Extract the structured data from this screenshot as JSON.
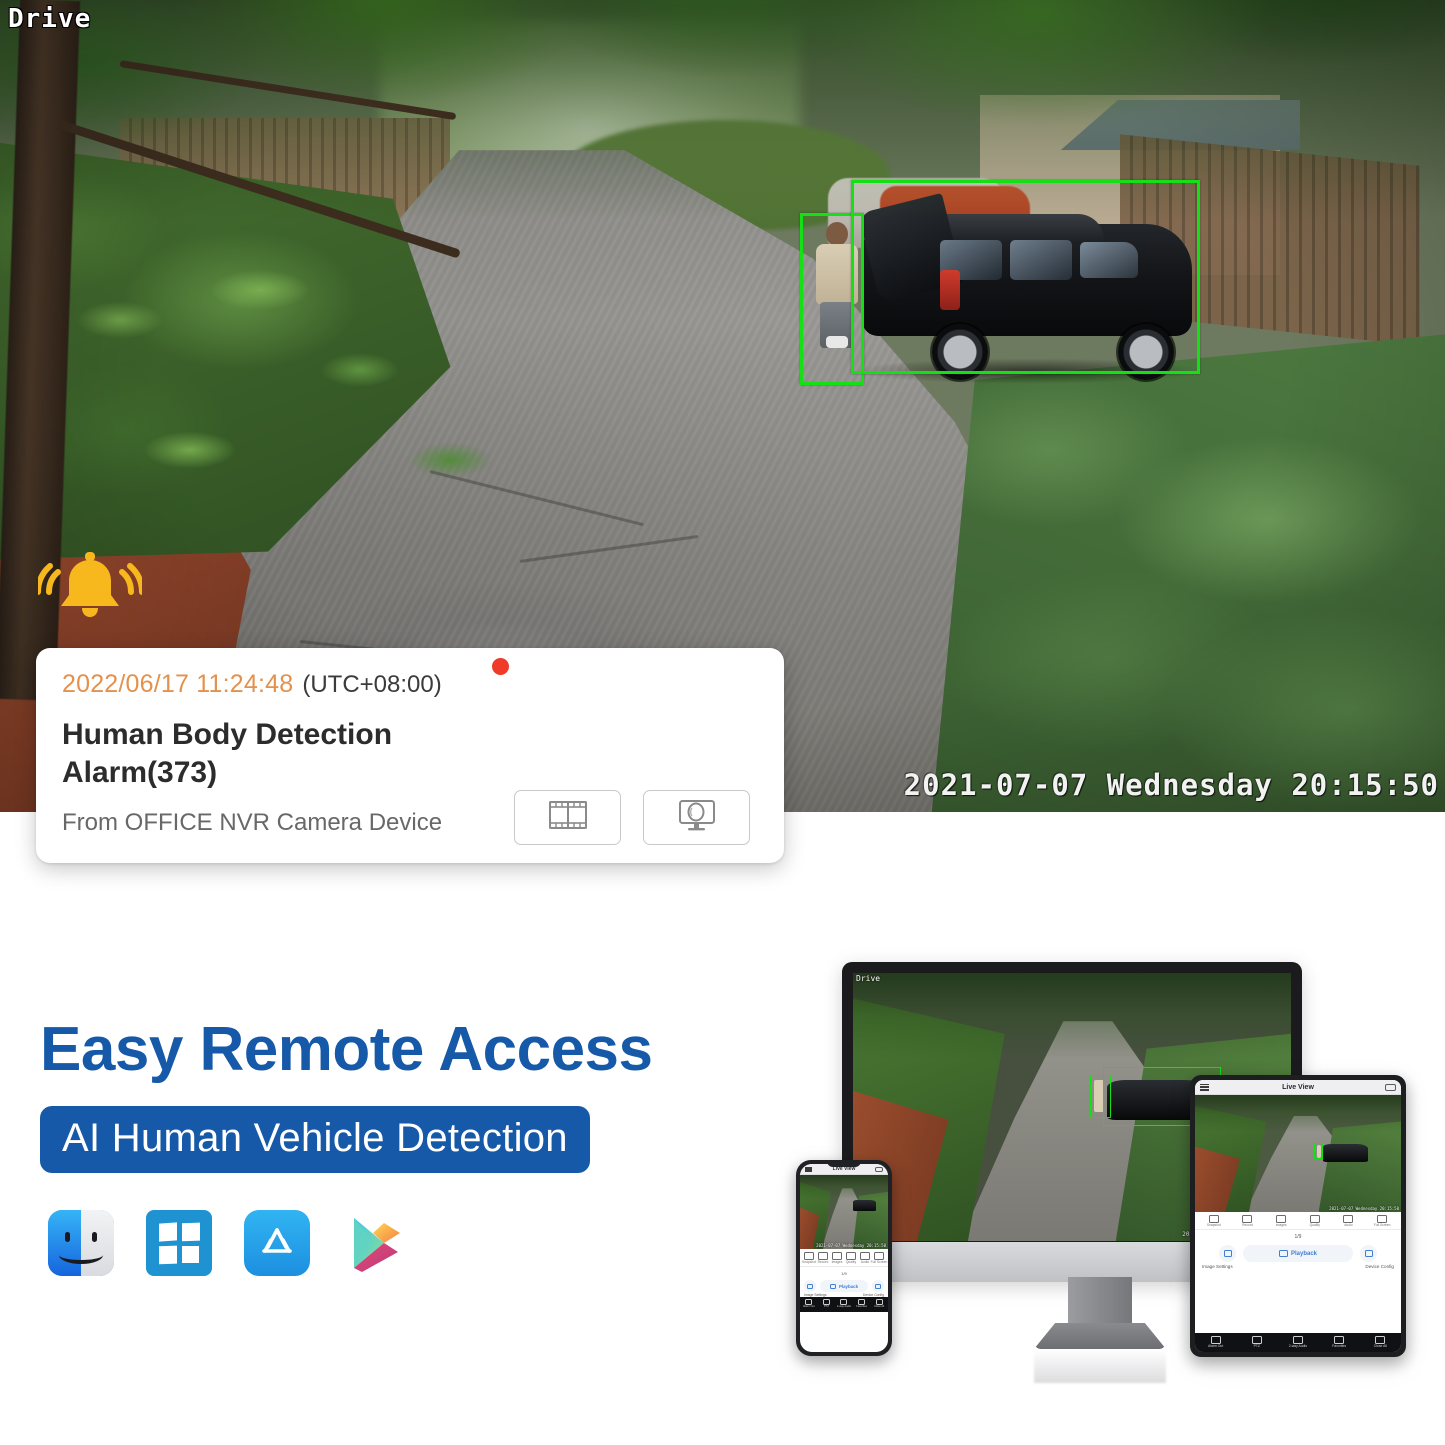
{
  "camera": {
    "channel_label": "Drive",
    "osd_timestamp": "2021-07-07 Wednesday 20:15:50",
    "detection_boxes": [
      {
        "name": "person",
        "color": "#15e015"
      },
      {
        "name": "vehicle",
        "color": "#15e015"
      }
    ],
    "bell_icon": "alarm-bell-icon",
    "bell_color": "#F6B81C"
  },
  "alert": {
    "date_time": "2022/06/17 11:24:48",
    "timezone": "(UTC+08:00)",
    "title": "Human Body Detection Alarm(373)",
    "source": "From OFFICE NVR Camera Device",
    "unread_dot_color": "#F03A2A",
    "date_color": "#E3914C",
    "actions": [
      {
        "name": "video-clip-button",
        "icon": "film-strip-icon"
      },
      {
        "name": "live-view-button",
        "icon": "monitor-camera-icon"
      }
    ]
  },
  "marketing": {
    "headline": "Easy Remote Access",
    "badge": "AI Human Vehicle Detection",
    "brand_blue": "#1559A8",
    "platforms": [
      {
        "name": "macos-finder-icon",
        "label": "macOS"
      },
      {
        "name": "windows-icon",
        "label": "Windows"
      },
      {
        "name": "app-store-icon",
        "label": "App Store"
      },
      {
        "name": "google-play-icon",
        "label": "Google Play"
      }
    ]
  },
  "app": {
    "header_title": "Live View",
    "page_indicator": "1/9",
    "toolbar": [
      {
        "label": "Snapshot",
        "icon": "snapshot-icon"
      },
      {
        "label": "Record",
        "icon": "record-icon"
      },
      {
        "label": "Images",
        "icon": "images-icon"
      },
      {
        "label": "Quality",
        "icon": "quality-icon"
      },
      {
        "label": "Audio",
        "icon": "audio-icon"
      },
      {
        "label": "Full Screen",
        "icon": "fullscreen-icon"
      }
    ],
    "actions": {
      "playback_label": "Playback",
      "image_settings_label": "Image Settings",
      "device_config_label": "Device Config"
    },
    "bottom_nav": [
      {
        "label": "Alarm Out",
        "icon": "alarm-out-icon"
      },
      {
        "label": "PTZ",
        "icon": "ptz-icon"
      },
      {
        "label": "2-way Audio",
        "icon": "two-way-audio-icon"
      },
      {
        "label": "Favorites",
        "icon": "favorites-icon"
      },
      {
        "label": "Close All",
        "icon": "close-all-icon"
      }
    ],
    "mini_osd": "2021-07-07 Wednesday 20:15:50"
  }
}
